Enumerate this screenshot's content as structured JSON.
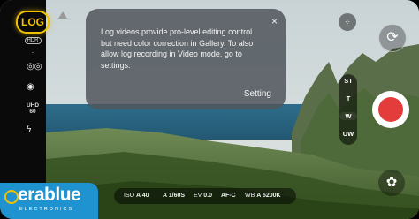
{
  "left_rail": {
    "log_label": "LOG",
    "hdr_label": "HDR",
    "resolution_label": "UHD",
    "fps_label": "60",
    "dash_label": "-"
  },
  "popup": {
    "message": "Log videos provide pro-level editing control but need color correction in Gallery. To also allow log recording in Video mode, go to settings.",
    "action_label": "Setting",
    "close_icon": "×"
  },
  "lens_options": [
    "ST",
    "T",
    "W",
    "UW"
  ],
  "active_lens": "W",
  "info_bar": {
    "iso_label": "ISO",
    "iso_value": "A 40",
    "shutter_value": "A 1/60S",
    "ev_label": "EV",
    "ev_value": "0.0",
    "focus_value": "AF-C",
    "wb_label": "WB",
    "wb_value": "A 5200K"
  },
  "watermark": {
    "brand": "erablue",
    "tagline": "ELECTRONICS"
  },
  "colors": {
    "log_accent": "#f2c200",
    "record": "#e43b3b",
    "brand_blue": "#1e93d0"
  }
}
